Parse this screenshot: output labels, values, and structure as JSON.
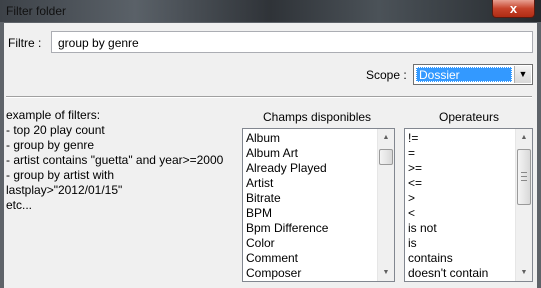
{
  "window": {
    "title": "Filter folder",
    "close_glyph": "x"
  },
  "filter": {
    "label": "Filtre :",
    "value": "group by genre"
  },
  "scope": {
    "label": "Scope :",
    "selected": "Dossier",
    "arrow": "▼"
  },
  "examples": [
    "example of filters:",
    "- top 20 play count",
    "- group by genre",
    "- artist contains \"guetta\" and year>=2000",
    "- group by artist with",
    "lastplay>\"2012/01/15\"",
    "etc..."
  ],
  "fields": {
    "header": "Champs disponibles",
    "items": [
      "Album",
      "Album Art",
      "Already Played",
      "Artist",
      "Bitrate",
      "BPM",
      "Bpm Difference",
      "Color",
      "Comment",
      "Composer"
    ]
  },
  "operators": {
    "header": "Operateurs",
    "items": [
      "!=",
      "=",
      ">=",
      "<=",
      ">",
      "<",
      "is not",
      "is",
      "contains",
      "doesn't contain"
    ]
  },
  "scroll": {
    "up": "▲",
    "down": "▼"
  }
}
